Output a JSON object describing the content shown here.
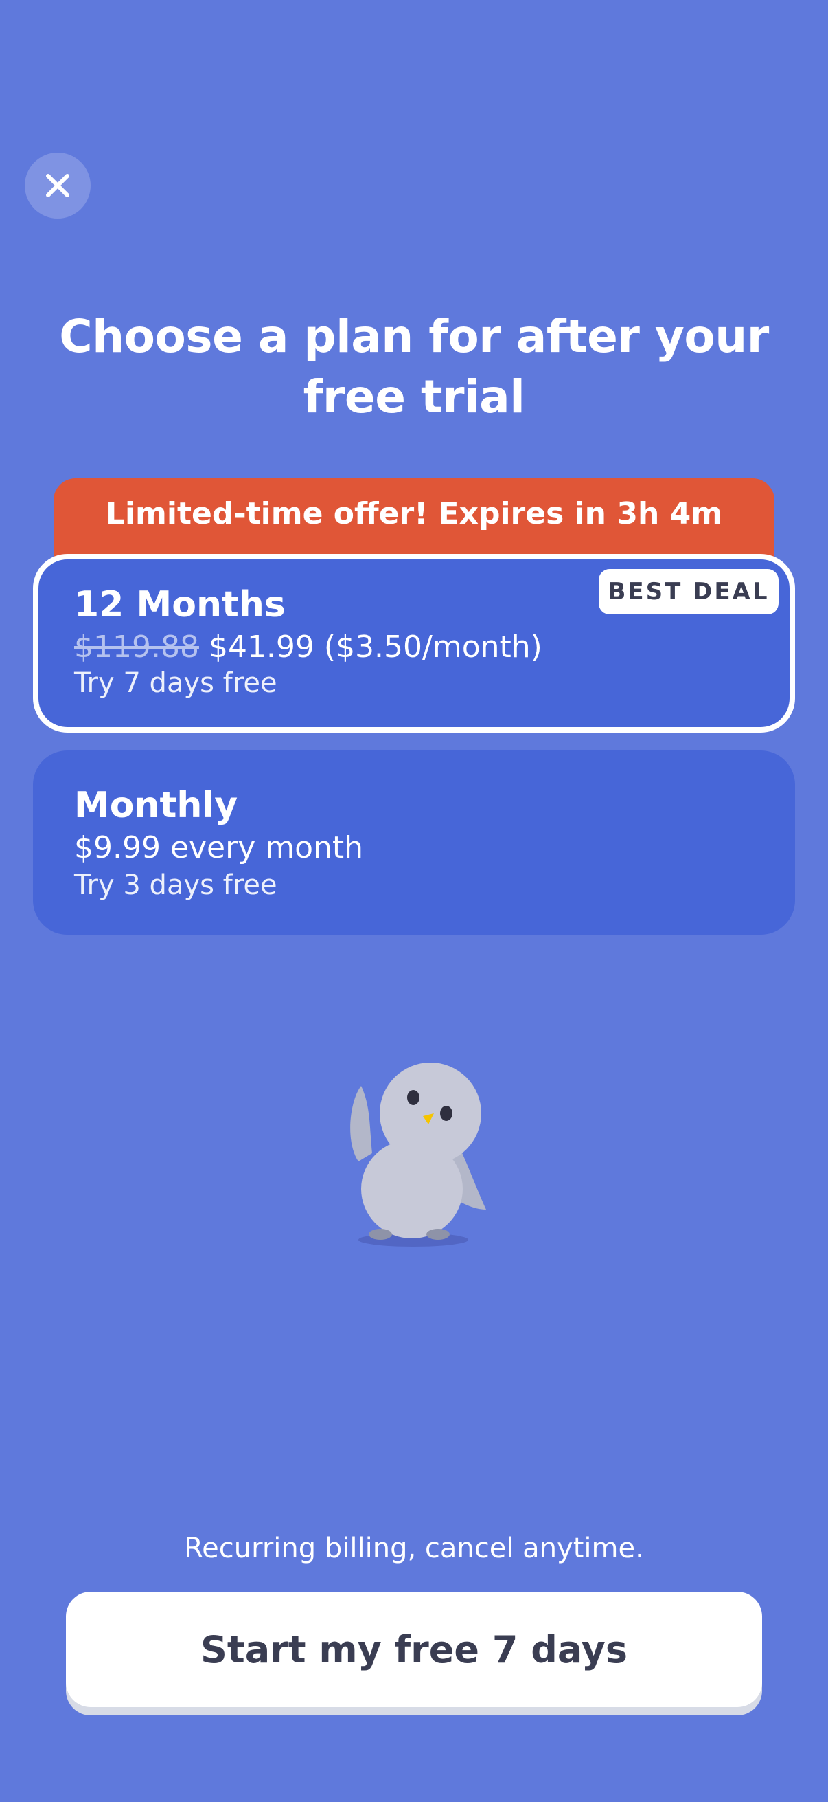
{
  "header": {
    "close_icon": "close-icon",
    "title": "Choose a plan for after your free trial"
  },
  "offer": {
    "text": "Limited-time offer! Expires in 3h 4m",
    "color": "#e05637"
  },
  "plans": [
    {
      "name": "12 Months",
      "original_price": "$119.88",
      "price": "$41.99 ($3.50/month)",
      "trial": "Try 7 days free",
      "badge": "BEST DEAL",
      "selected": true
    },
    {
      "name": "Monthly",
      "price": "$9.99 every month",
      "trial": "Try 3 days free",
      "selected": false
    }
  ],
  "mascot": {
    "icon": "owl-mascot-icon"
  },
  "footer": {
    "note": "Recurring billing, cancel anytime.",
    "cta_label": "Start my free 7 days"
  },
  "colors": {
    "background": "#5f79dc",
    "card": "#4766d8",
    "text_dark": "#3a3d52"
  }
}
